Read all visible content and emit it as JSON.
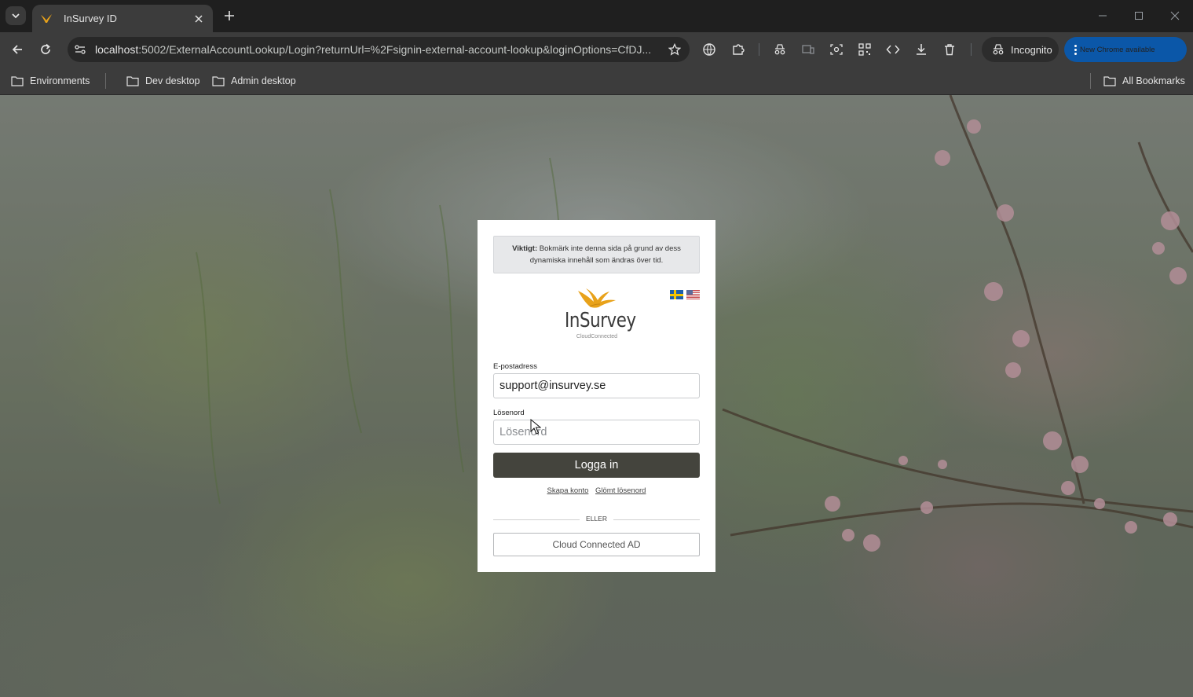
{
  "browser": {
    "tab": {
      "title": "InSurvey ID"
    },
    "address_bar": {
      "host": "localhost",
      "rest": ":5002/ExternalAccountLookup/Login?returnUrl=%2Fsignin-external-account-lookup&loginOptions=CfDJ..."
    },
    "incognito_label": "Incognito",
    "update_label": "New Chrome available",
    "bookmarks": {
      "items": [
        "Environments",
        "Dev desktop",
        "Admin desktop"
      ],
      "all_bookmarks": "All Bookmarks"
    }
  },
  "login": {
    "notice": {
      "bold": "Viktigt:",
      "text": "Bokmärk inte denna sida på grund av dess dynamiska innehåll som ändras över tid."
    },
    "logo": {
      "word": "InSurvey",
      "sub": "CloudConnected"
    },
    "email": {
      "label": "E-postadress",
      "value": "support@insurvey.se"
    },
    "password": {
      "label": "Lösenord",
      "placeholder": "Lösenord"
    },
    "login_button": "Logga in",
    "links": {
      "create_account": "Skapa konto",
      "forgot_password": "Glömt lösenord"
    },
    "divider": "ELLER",
    "external_provider": "Cloud Connected AD"
  },
  "colors": {
    "brand_gold": "#e8a21a",
    "login_button": "#44443d",
    "update_button": "#0b57a8"
  }
}
